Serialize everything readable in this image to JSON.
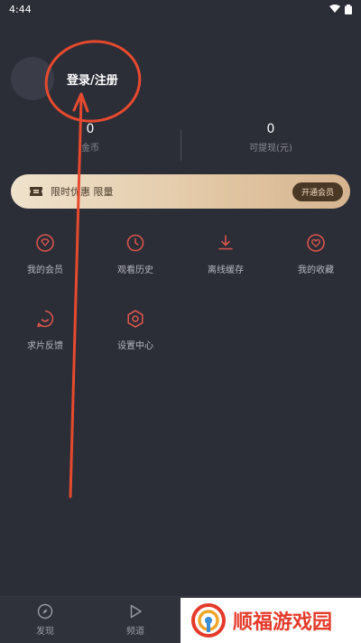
{
  "status_bar": {
    "time": "4:44"
  },
  "profile": {
    "login_label": "登录/注册"
  },
  "stats": [
    {
      "value": "0",
      "label": "金币"
    },
    {
      "value": "0",
      "label": "可提现(元)"
    }
  ],
  "vip_banner": {
    "text": "限时优惠 限量",
    "button_label": "开通会员"
  },
  "menu": [
    {
      "label": "我的会员",
      "icon": "heart-diamond-icon"
    },
    {
      "label": "观看历史",
      "icon": "clock-icon"
    },
    {
      "label": "离线缓存",
      "icon": "download-icon"
    },
    {
      "label": "我的收藏",
      "icon": "heart-icon"
    },
    {
      "label": "求片反馈",
      "icon": "smile-icon"
    },
    {
      "label": "设置中心",
      "icon": "gear-icon"
    }
  ],
  "tabs": [
    {
      "label": "发现",
      "icon": "compass-icon"
    },
    {
      "label": "频道",
      "icon": "play-icon"
    }
  ],
  "watermark": {
    "text": "顺福游戏园"
  },
  "colors": {
    "accent": "#d8554a",
    "annotation": "#e64a2e",
    "background": "#2b2d37"
  }
}
